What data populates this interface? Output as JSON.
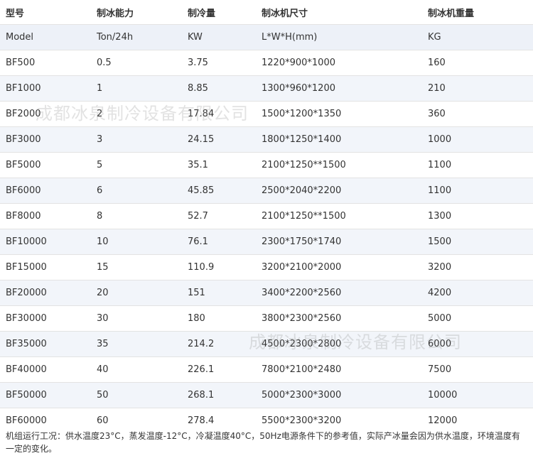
{
  "table": {
    "headers": [
      "型号",
      "制冰能力",
      "制冷量",
      "制冰机尺寸",
      "制冰机重量"
    ],
    "units": [
      "Model",
      "Ton/24h",
      "KW",
      "L*W*H(mm)",
      "KG"
    ],
    "rows": [
      [
        "BF500",
        "0.5",
        "3.75",
        "1220*900*1000",
        "160"
      ],
      [
        "BF1000",
        "1",
        "8.85",
        "1300*960*1200",
        "210"
      ],
      [
        "BF2000",
        "2",
        "17.84",
        "1500*1200*1350",
        "360"
      ],
      [
        "BF3000",
        "3",
        "24.15",
        "1800*1250*1400",
        "1000"
      ],
      [
        "BF5000",
        "5",
        "35.1",
        "2100*1250**1500",
        "1100"
      ],
      [
        "BF6000",
        "6",
        "45.85",
        "2500*2040*2200",
        "1100"
      ],
      [
        "BF8000",
        "8",
        "52.7",
        "2100*1250**1500",
        "1300"
      ],
      [
        "BF10000",
        "10",
        "76.1",
        "2300*1750*1740",
        "1500"
      ],
      [
        "BF15000",
        "15",
        "110.9",
        "3200*2100*2000",
        "3200"
      ],
      [
        "BF20000",
        "20",
        "151",
        "3400*2200*2560",
        "4200"
      ],
      [
        "BF30000",
        "30",
        "180",
        "3800*2300*2560",
        "5000"
      ],
      [
        "BF35000",
        "35",
        "214.2",
        "4500*2300*2800",
        "6000"
      ],
      [
        "BF40000",
        "40",
        "226.1",
        "7800*2100*2480",
        "7500"
      ],
      [
        "BF50000",
        "50",
        "268.1",
        "5000*2300*3000",
        "10000"
      ],
      [
        "BF60000",
        "60",
        "278.4",
        "5500*2300*3200",
        "12000"
      ]
    ]
  },
  "note": "机组运行工况：供水温度23°C，蒸发温度-12°C，冷凝温度40°C，50Hz电源条件下的参考值，实际产冰量会因为供水温度，环境温度有一定的变化。",
  "watermarks": [
    "成都冰泉制冷设备有限公司",
    "成都冰泉制冷设备有限公司"
  ]
}
